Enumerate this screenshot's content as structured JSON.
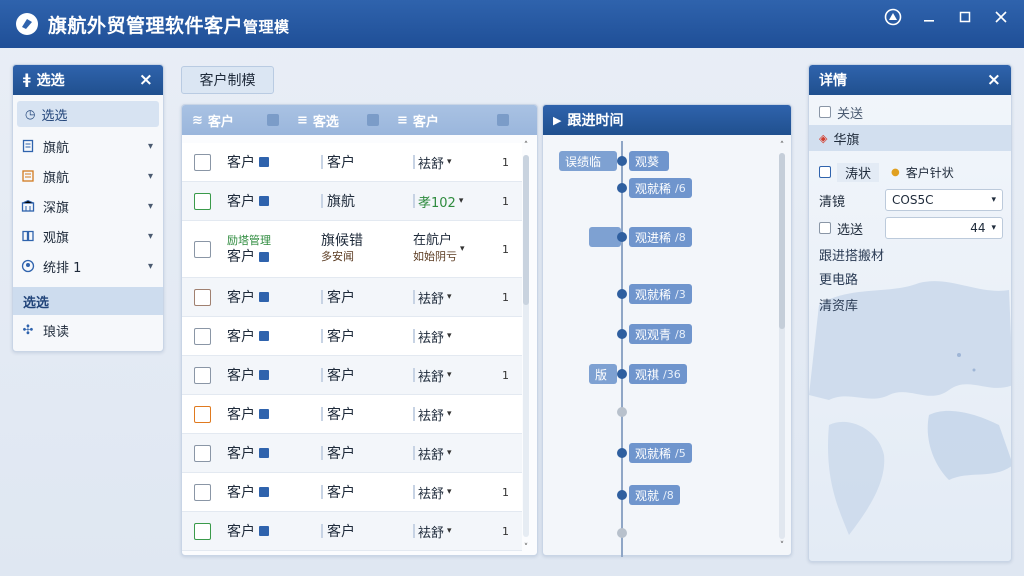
{
  "app": {
    "title": "旗航外贸管理软件客户",
    "title_suffix": "管理模"
  },
  "window_controls": [
    "notify-icon",
    "minimize-icon",
    "maximize-icon",
    "close-icon"
  ],
  "left_panel": {
    "title": "选选",
    "filter_all": "选选",
    "items": [
      {
        "label": "旗航",
        "icon": "document-icon"
      },
      {
        "label": "旗航",
        "icon": "folder-icon"
      },
      {
        "label": "深旗",
        "icon": "building-icon"
      },
      {
        "label": "观旗",
        "icon": "book-icon"
      },
      {
        "label": "统排 1",
        "icon": "user-icon"
      }
    ],
    "subhead": "选选",
    "extra_item": {
      "label": "琅读",
      "icon": "puzzle-icon"
    }
  },
  "tab": {
    "label": "客户制模"
  },
  "table": {
    "headers": [
      "客户",
      "客选",
      "客户"
    ],
    "rows": [
      {
        "c1": "客户",
        "c2": "客户",
        "c3": "袪舒",
        "c4": "1",
        "check": "grey"
      },
      {
        "c1": "客户",
        "c2": "旗航",
        "c3": "孝102",
        "c4": "1",
        "check": "green"
      },
      {
        "c1": "客户",
        "c1_top": "励塔管理",
        "c2": "旗候错",
        "c2_sub": "多安闻",
        "c3": "在航户",
        "c3_sub": "如始阴亏",
        "c4": "1",
        "check": "grey",
        "tall": true
      },
      {
        "c1": "客户",
        "c2": "客户",
        "c3": "袪舒",
        "c4": "1",
        "check": "brown"
      },
      {
        "c1": "客户",
        "c2": "客户",
        "c3": "袪舒",
        "c4": "",
        "check": "grey"
      },
      {
        "c1": "客户",
        "c2": "客户",
        "c3": "袪舒",
        "c4": "1",
        "check": "grey"
      },
      {
        "c1": "客户",
        "c2": "客户",
        "c3": "袪舒",
        "c4": "",
        "check": "orange"
      },
      {
        "c1": "客户",
        "c2": "客户",
        "c3": "袪舒",
        "c4": "",
        "check": "grey"
      },
      {
        "c1": "客户",
        "c2": "客户",
        "c3": "袪舒",
        "c4": "1",
        "check": "grey"
      },
      {
        "c1": "客户",
        "c2": "客户",
        "c3": "袪舒",
        "c4": "1",
        "check": "green"
      }
    ]
  },
  "timeline": {
    "title": "跟进时间",
    "entries": [
      {
        "left": "误绩临",
        "label": "观葵",
        "num": ""
      },
      {
        "left": "",
        "label": "观就稀",
        "num": "/6"
      },
      {
        "left": "",
        "label": "观进稀",
        "num": "/8",
        "left_blank": true
      },
      {
        "left": "",
        "label": "观就稀",
        "num": "/3"
      },
      {
        "left": "",
        "label": "观观青",
        "num": "/8"
      },
      {
        "left": "版",
        "label": "观祺",
        "num": "/36"
      },
      {
        "left": "",
        "label": "",
        "num": "",
        "grey": true
      },
      {
        "left": "",
        "label": "观就稀",
        "num": "/5"
      },
      {
        "left": "",
        "label": "观就",
        "num": "/8"
      },
      {
        "left": "",
        "label": "",
        "num": "",
        "grey": true
      }
    ]
  },
  "details": {
    "title": "详情",
    "row1": "关送",
    "row2": "华旗",
    "check_label": "涛状",
    "tag_label": "客户针状",
    "field1_label": "清镜",
    "field1_value": "COS5C",
    "field2_label": "选送",
    "field2_value": "44",
    "links": [
      "跟进搭搬材",
      "更电路",
      "清资库"
    ]
  }
}
